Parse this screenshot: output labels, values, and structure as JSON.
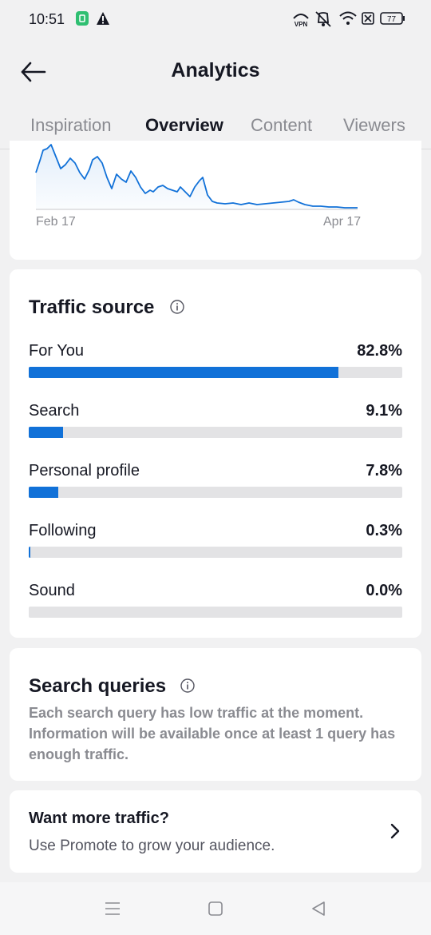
{
  "status_bar": {
    "time": "10:51",
    "battery": "77",
    "icons": [
      "app-notification-icon",
      "warning-icon",
      "vpn-icon",
      "mute-icon",
      "wifi-icon",
      "sim-icon",
      "battery-icon"
    ]
  },
  "header": {
    "title": "Analytics",
    "back_icon": "back-arrow-icon"
  },
  "tabs": [
    {
      "label": "Inspiration",
      "active": false
    },
    {
      "label": "Overview",
      "active": true
    },
    {
      "label": "Content",
      "active": false
    },
    {
      "label": "Viewers",
      "active": false
    }
  ],
  "chart": {
    "x_start_label": "Feb 17",
    "x_end_label": "Apr 17",
    "line_color": "#1171d8"
  },
  "traffic_source": {
    "title": "Traffic source",
    "items": [
      {
        "label": "For You",
        "value": "82.8%",
        "percent": 82.8
      },
      {
        "label": "Search",
        "value": "9.1%",
        "percent": 9.1
      },
      {
        "label": "Personal profile",
        "value": "7.8%",
        "percent": 7.8
      },
      {
        "label": "Following",
        "value": "0.3%",
        "percent": 0.3
      },
      {
        "label": "Sound",
        "value": "0.0%",
        "percent": 0.0
      }
    ]
  },
  "search_queries": {
    "title": "Search queries",
    "description": "Each search query has low traffic at the moment. Information will be available once at least 1 query has enough traffic."
  },
  "promote": {
    "title": "Want more traffic?",
    "subtitle": "Use Promote to grow your audience."
  },
  "nav_bar": {
    "icons": [
      "menu-icon",
      "home-icon",
      "back-icon"
    ]
  },
  "colors": {
    "accent": "#1171d8",
    "track": "#e3e3e5",
    "background": "#f1f1f2"
  }
}
